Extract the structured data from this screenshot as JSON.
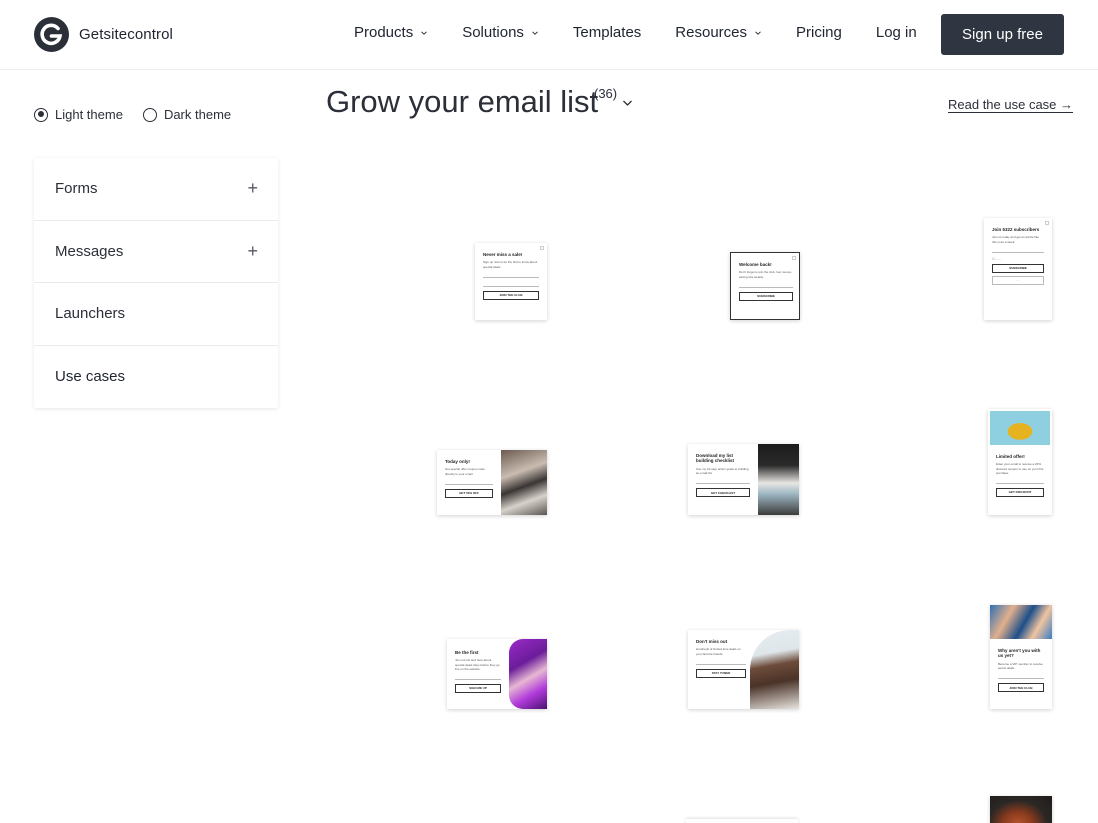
{
  "brand": {
    "name": "Getsitecontrol"
  },
  "nav": {
    "items": [
      {
        "label": "Products",
        "dropdown": true
      },
      {
        "label": "Solutions",
        "dropdown": true
      },
      {
        "label": "Templates",
        "dropdown": false
      },
      {
        "label": "Resources",
        "dropdown": true
      },
      {
        "label": "Pricing",
        "dropdown": false
      },
      {
        "label": "Log in",
        "dropdown": false
      }
    ],
    "signup_label": "Sign up free"
  },
  "theme": {
    "light_label": "Light theme",
    "dark_label": "Dark theme",
    "selected": "light"
  },
  "sidebar": {
    "items": [
      {
        "label": "Forms",
        "expandable": true
      },
      {
        "label": "Messages",
        "expandable": true
      },
      {
        "label": "Launchers",
        "expandable": false
      },
      {
        "label": "Use cases",
        "expandable": false
      }
    ]
  },
  "main": {
    "title": "Grow your email list",
    "count": "(36)",
    "read_link": "Read the use case →"
  },
  "cards": [
    {
      "heading": "Never miss a sale!",
      "text": "Sign up now to be the first to know about special deals",
      "button": "JOIN THE CLUB"
    },
    {
      "heading": "Welcome back!",
      "text": "Don't forget to join the club. Get money-saving tips weekly.",
      "button": "SUBSCRIBE"
    },
    {
      "heading": "Join 5322 subscribers",
      "text": "Join us today and get an article like this once a week.",
      "button": "SUBSCRIBE"
    },
    {
      "heading": "Today only!",
      "text": "Get special offer coupon code directly to your email",
      "button": "GET 50% OFF"
    },
    {
      "heading": "Download my list building checklist",
      "text": "Use my 10-step action guide to building an email list.",
      "button": "GET CHECKLIST"
    },
    {
      "heading": "Limited offer!",
      "text": "Enter your email to receive a 20% discount coupon to use on your first purchase.",
      "button": "GET DISCOUNT"
    },
    {
      "heading": "Be the first",
      "text": "Join our list and hear about special deals days before they go live on the website.",
      "button": "SIGN ME UP"
    },
    {
      "heading": "Don't miss out",
      "text": "Hundreds of limited-time deals on your favorite brands",
      "button": "STAY TUNED"
    },
    {
      "heading": "Why aren't you with us yet?",
      "text": "Become a VIP member to receive secret deals.",
      "button": "JOIN THE CLUB"
    }
  ],
  "colors": {
    "primary_button": "#2f3541",
    "text": "#1f2430"
  }
}
